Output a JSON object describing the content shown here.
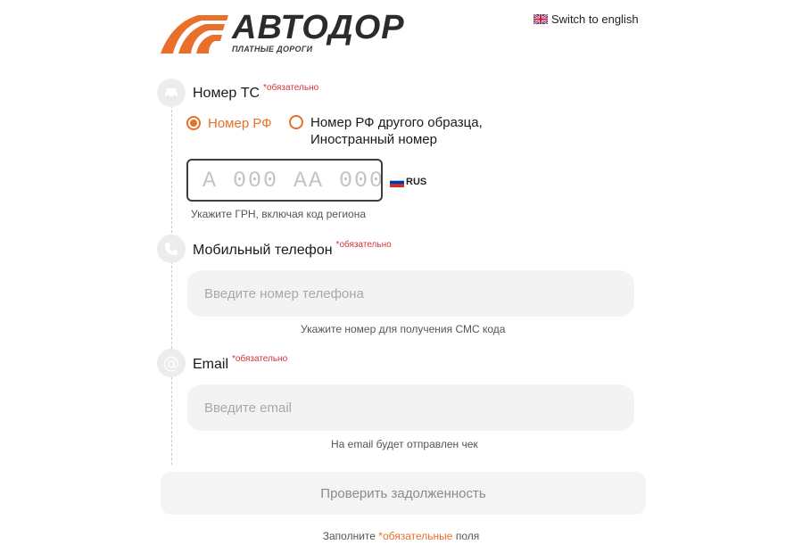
{
  "brand": {
    "name": "АВТОДОР",
    "tagline": "ПЛАТНЫЕ ДОРОГИ",
    "accent_color": "#e8702a"
  },
  "language": {
    "icon": "uk-flag-icon",
    "label": "Switch to english"
  },
  "required_mark": "*обязательно",
  "vehicle": {
    "icon": "car-icon",
    "label": "Номер ТС",
    "options": [
      {
        "label": "Номер РФ",
        "selected": true
      },
      {
        "label_line1": "Номер РФ другого образца,",
        "label_line2": "Иностранный номер",
        "selected": false
      }
    ],
    "plate_placeholder": "А 000 АА 000",
    "plate_value": "",
    "country_icon": "russia-flag-icon",
    "country_code": "RUS",
    "hint": "Укажите ГРН, включая код региона"
  },
  "phone": {
    "icon": "phone-icon",
    "label": "Мобильный телефон",
    "placeholder": "Введите номер телефона",
    "value": "",
    "hint": "Укажите номер для получения СМС кода"
  },
  "email": {
    "icon": "at-icon",
    "label": "Email",
    "placeholder": "Введите email",
    "value": "",
    "hint": "На email будет отправлен чек"
  },
  "submit": {
    "label": "Проверить задолженность"
  },
  "footer": {
    "before": "Заполните",
    "required_words": "*обязательные",
    "after": "поля"
  }
}
